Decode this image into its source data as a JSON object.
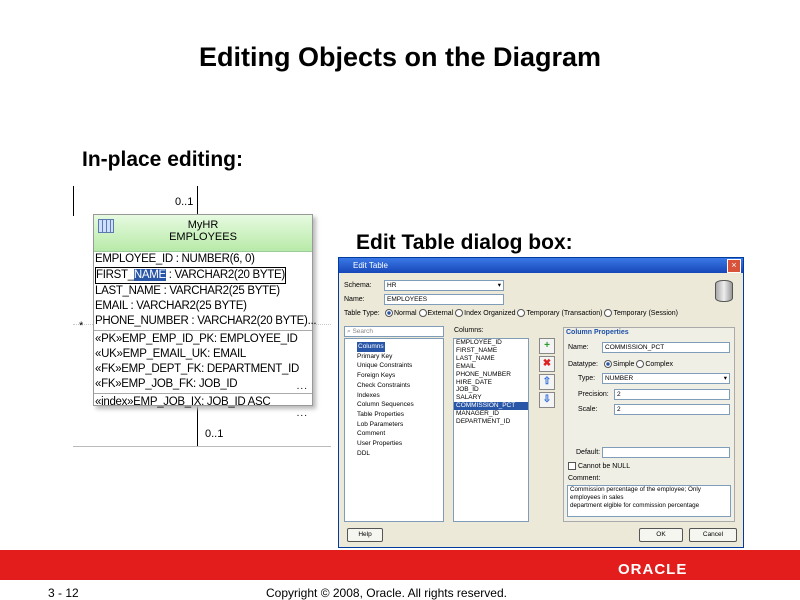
{
  "slide": {
    "title": "Editing Objects on the Diagram",
    "inplace_heading": "In-place editing:",
    "dialog_heading": "Edit Table dialog box:"
  },
  "diagram": {
    "cardinality_top": "0..1",
    "cardinality_bottom": "0..1",
    "star": "*",
    "entity": {
      "schema": "MyHR",
      "name": "EMPLOYEES",
      "columns": [
        "EMPLOYEE_ID : NUMBER(6, 0)",
        "LAST_NAME : VARCHAR2(25 BYTE)",
        "EMAIL : VARCHAR2(25 BYTE)",
        "PHONE_NUMBER : VARCHAR2(20 BYTE)..."
      ],
      "editing_row": {
        "prefix": "FIRST_",
        "selected": "NAME",
        "rest": " : VARCHAR2(20 BYTE)"
      },
      "constraints": [
        "«PK»EMP_EMP_ID_PK: EMPLOYEE_ID",
        "«UK»EMP_EMAIL_UK: EMAIL",
        "«FK»EMP_DEPT_FK: DEPARTMENT_ID",
        "«FK»EMP_JOB_FK: JOB_ID"
      ],
      "indexes": [
        "«index»EMP_JOB_IX: JOB_ID ASC"
      ],
      "more": "..."
    }
  },
  "dialog": {
    "title": "Edit Table",
    "close_glyph": "×",
    "schema_label": "Schema:",
    "schema_value": "HR",
    "name_label": "Name:",
    "name_value": "EMPLOYEES",
    "table_type_label": "Table Type:",
    "table_types": [
      "Normal",
      "External",
      "Index Organized",
      "Temporary (Transaction)",
      "Temporary (Session)"
    ],
    "search_placeholder": "Search",
    "tree": [
      "Columns",
      "Primary Key",
      "Unique Constraints",
      "Foreign Keys",
      "Check Constraints",
      "Indexes",
      "Column Sequences",
      "Table Properties",
      "Lob Parameters",
      "Comment",
      "User Properties",
      "DDL"
    ],
    "columns_label": "Columns:",
    "columns": [
      "EMPLOYEE_ID",
      "FIRST_NAME",
      "LAST_NAME",
      "EMAIL",
      "PHONE_NUMBER",
      "HIRE_DATE",
      "JOB_ID",
      "SALARY",
      "COMMISSION_PCT",
      "MANAGER_ID",
      "DEPARTMENT_ID"
    ],
    "selected_column": "COMMISSION_PCT",
    "column_props_title": "Column Properties",
    "prop_name_label": "Name:",
    "prop_name_value": "COMMISSION_PCT",
    "datatype_label": "Datatype:",
    "datatype_simple": "Simple",
    "datatype_complex": "Complex",
    "type_label": "Type:",
    "type_value": "NUMBER",
    "precision_label": "Precision:",
    "precision_value": "2",
    "scale_label": "Scale:",
    "scale_value": "2",
    "default_label": "Default:",
    "default_value": "",
    "notnull_label": "Cannot be NULL",
    "comment_label": "Comment:",
    "comment_lines": [
      "Commission percentage of the employee; Only",
      "employees in sales",
      "department elgible for commission percentage"
    ],
    "help_label": "Help",
    "ok_label": "OK",
    "cancel_label": "Cancel"
  },
  "footer": {
    "page": "3 - 12",
    "copyright": "Copyright © 2008, Oracle. All rights reserved.",
    "brand": "ORACLE"
  },
  "colors": {
    "brand_red": "#e31c1c",
    "header_green": "#b8eaa8",
    "selection_blue": "#2a56a8"
  }
}
